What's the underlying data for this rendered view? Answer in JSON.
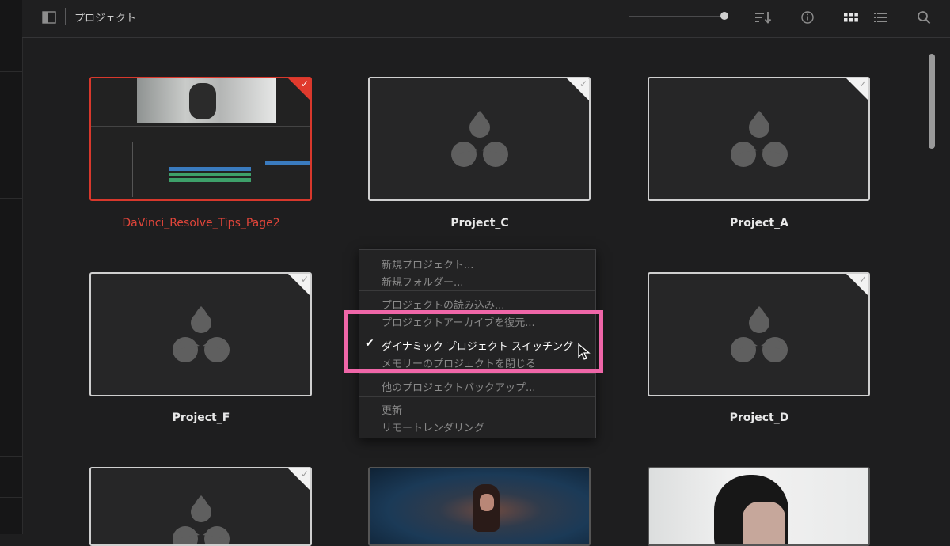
{
  "header": {
    "title": "プロジェクト",
    "zoom_level": 1.0
  },
  "icons": {
    "panel_toggle": "panel-toggle-icon",
    "sort": "sort-icon",
    "info": "info-icon",
    "grid_view": "grid-view-icon",
    "list_view": "list-view-icon",
    "search": "search-icon",
    "project_placeholder": "davinci-resolve-logo-icon",
    "selected_check": "checkmark-icon"
  },
  "projects": [
    {
      "name": "DaVinci_Resolve_Tips_Page2",
      "thumbnail": "timeline-screenshot",
      "active": true
    },
    {
      "name": "Project_C",
      "thumbnail": "placeholder-logo",
      "active": false
    },
    {
      "name": "Project_A",
      "thumbnail": "placeholder-logo",
      "active": false
    },
    {
      "name": "Project_F",
      "thumbnail": "placeholder-logo",
      "active": false
    },
    {
      "name": "Project_D",
      "thumbnail": "placeholder-logo",
      "active": false
    },
    {
      "name": "",
      "thumbnail": "placeholder-logo",
      "active": false
    },
    {
      "name": "",
      "thumbnail": "photo",
      "active": false
    },
    {
      "name": "",
      "thumbnail": "photo",
      "active": false
    }
  ],
  "context_menu": {
    "items": [
      {
        "label": "新規プロジェクト..."
      },
      {
        "label": "新規フォルダー..."
      },
      {
        "label": "プロジェクトの読み込み..."
      },
      {
        "label": "プロジェクトアーカイブを復元..."
      },
      {
        "label": "ダイナミック プロジェクト スイッチング",
        "checked": true
      },
      {
        "label": "メモリーのプロジェクトを閉じる"
      },
      {
        "label": "他のプロジェクトバックアップ..."
      },
      {
        "label": "更新"
      },
      {
        "label": "リモートレンダリング"
      }
    ]
  },
  "colors": {
    "active_accent": "#e03a2d",
    "highlight_frame": "#ef66a8",
    "background": "#1e1e1f"
  }
}
